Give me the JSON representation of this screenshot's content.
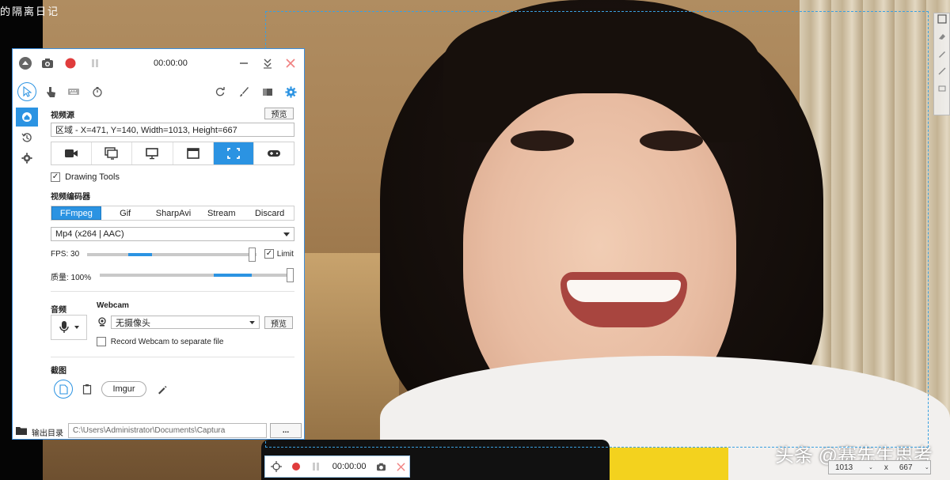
{
  "background": {
    "corner_title": "的隔离日记",
    "watermark": "头条 @赛先生思考"
  },
  "window": {
    "timer": "00:00:00",
    "video_source": {
      "label": "视频源",
      "preview_button": "预览",
      "region_text": "区域 - X=471, Y=140, Width=1013, Height=667"
    },
    "drawing_tools_label": "Drawing Tools",
    "encoder": {
      "label": "视频编码器",
      "tabs": [
        "FFmpeg",
        "Gif",
        "SharpAvi",
        "Stream",
        "Discard"
      ],
      "selected_format": "Mp4 (x264 | AAC)"
    },
    "fps": {
      "label": "FPS: 30",
      "value": 30,
      "limit_label": "Limit"
    },
    "quality": {
      "label": "质量: 100%",
      "value": 100
    },
    "audio_label": "音频",
    "webcam": {
      "label": "Webcam",
      "selected": "无摄像头",
      "preview_button": "预览",
      "separate_file_label": "Record Webcam to separate file"
    },
    "screenshot": {
      "label": "截图",
      "imgur_button": "Imgur"
    },
    "footer": {
      "output_label": "输出目录",
      "output_path": "C:\\Users\\Administrator\\Documents\\Captura",
      "more_button": "..."
    }
  },
  "mini_bar": {
    "timer": "00:00:00"
  },
  "size_box": {
    "width": "1013",
    "separator": "x",
    "height": "667"
  },
  "colors": {
    "accent": "#2b93e2",
    "record": "#e03c3c",
    "selection_border": "#3aa0e0"
  }
}
